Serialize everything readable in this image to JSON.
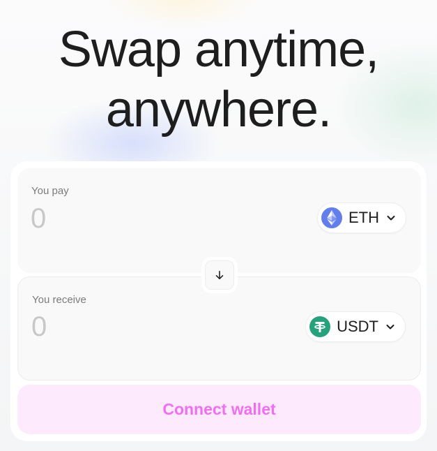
{
  "hero": {
    "title_line1": "Swap anytime,",
    "title_line2": "anywhere."
  },
  "pay": {
    "label": "You pay",
    "placeholder": "0",
    "token": {
      "symbol": "ETH",
      "icon": "ethereum-icon",
      "color": "#627eea"
    }
  },
  "receive": {
    "label": "You receive",
    "placeholder": "0",
    "token": {
      "symbol": "USDT",
      "icon": "tether-icon",
      "color": "#26a17b"
    }
  },
  "switch": {
    "icon": "arrow-down-icon"
  },
  "connect": {
    "label": "Connect wallet",
    "background": "#fdeafd",
    "text_color": "#f06ff0"
  }
}
